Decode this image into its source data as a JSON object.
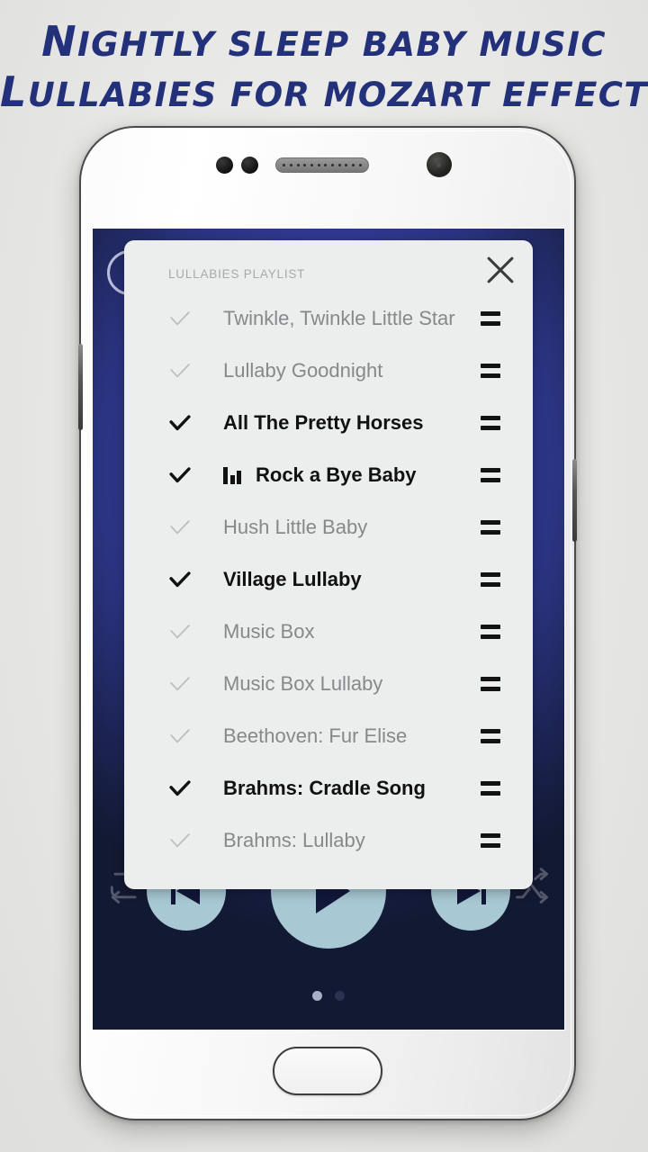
{
  "promo": {
    "headline_line1": "Nightly sleep baby music",
    "headline_line2": "Lullabies for Mozart effect",
    "headline_color": "#23307a",
    "background_color": "#e9e9e7"
  },
  "device": {
    "body_color": "#f4f4f4",
    "icons": {
      "sensor": "proximity-sensor-icon",
      "speaker": "earpiece-speaker-icon",
      "camera": "front-camera-icon",
      "home": "home-button",
      "volume": "volume-button",
      "power": "power-button"
    }
  },
  "app": {
    "background_color": "#2f3a91",
    "accent_color": "#a8c8d4",
    "timer_icon": "clock-timer-icon"
  },
  "playlist": {
    "title": "LULLABIES PLAYLIST",
    "close_label": "close-icon",
    "tracks": [
      {
        "title": "Twinkle, Twinkle Little Star",
        "selected": false,
        "playing": false
      },
      {
        "title": "Lullaby Goodnight",
        "selected": false,
        "playing": false
      },
      {
        "title": "All The Pretty Horses",
        "selected": true,
        "playing": false
      },
      {
        "title": "Rock a Bye Baby",
        "selected": true,
        "playing": true
      },
      {
        "title": "Hush Little Baby",
        "selected": false,
        "playing": false
      },
      {
        "title": "Village Lullaby",
        "selected": true,
        "playing": false
      },
      {
        "title": "Music Box",
        "selected": false,
        "playing": false
      },
      {
        "title": "Music Box Lullaby",
        "selected": false,
        "playing": false
      },
      {
        "title": "Beethoven: Fur Elise",
        "selected": false,
        "playing": false
      },
      {
        "title": "Brahms: Cradle Song",
        "selected": true,
        "playing": false
      },
      {
        "title": "Brahms: Lullaby",
        "selected": false,
        "playing": false
      }
    ]
  },
  "player": {
    "repeat_label": "repeat-icon",
    "previous_label": "previous-track-icon",
    "play_label": "play-icon",
    "next_label": "next-track-icon",
    "shuffle_label": "shuffle-icon",
    "pages": 2,
    "active_page": 1
  }
}
